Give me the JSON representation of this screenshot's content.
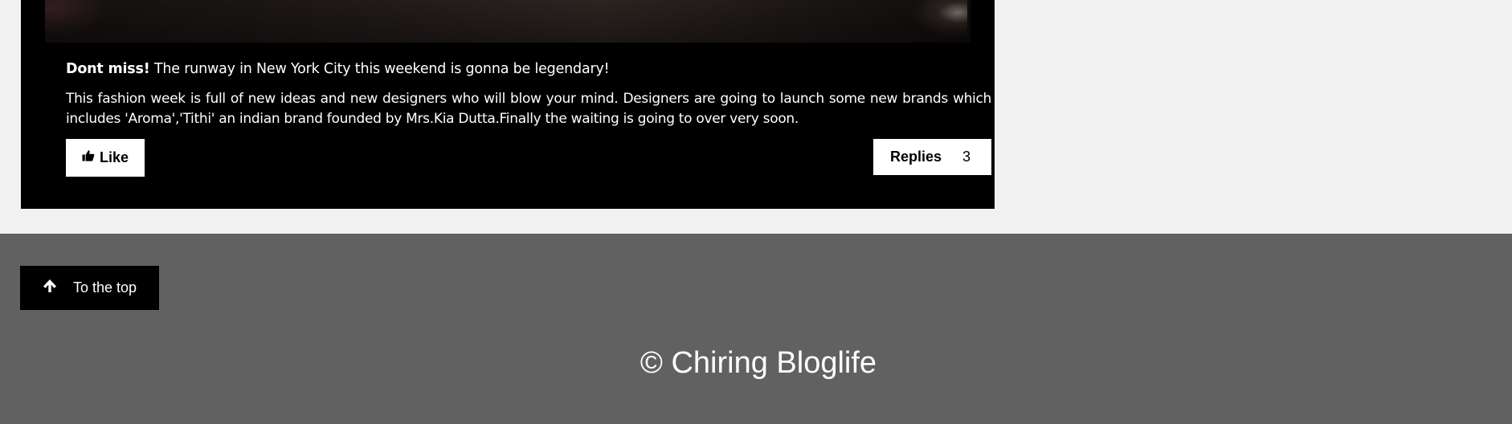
{
  "post": {
    "headline_bold": "Dont miss!",
    "headline_rest": " The runway in New York City this weekend is gonna be legendary!",
    "body": "This fashion week is full of new ideas and new designers who will blow your mind. Designers are going to launch some new brands which includes 'Aroma','Tithi' an indian brand founded by Mrs.Kia Dutta.Finally the waiting is going to over very soon.",
    "like_label": "Like",
    "like_icon": "thumbs-up-icon",
    "replies_label": "Replies",
    "replies_count": "3"
  },
  "footer": {
    "top_button_label": "To the top",
    "top_button_icon": "arrow-up-icon",
    "copyright": "© Chiring Bloglife"
  },
  "colors": {
    "page_background": "#f1f1f1",
    "card_background": "#000000",
    "footer_background": "#616161",
    "button_light": "#ffffff",
    "button_dark": "#000000"
  }
}
